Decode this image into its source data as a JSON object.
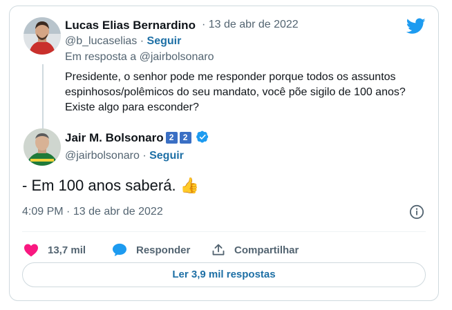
{
  "reply": {
    "author_name": "Lucas Elias Bernardino",
    "date": "13 de abr de 2022",
    "separator": "·",
    "handle": "@b_lucaselias",
    "follow_label": "Seguir",
    "in_reply_to_prefix": "Em resposta a",
    "in_reply_to_handle": "@jairbolsonaro",
    "text": "Presidente, o senhor pode me responder porque todos os assuntos espinhosos/polêmicos do seu mandato, você põe sigilo de 100 anos? Existe algo para esconder?"
  },
  "main": {
    "author_name": "Jair M. Bolsonaro",
    "badge_1": "2",
    "badge_2": "2",
    "handle": "@jairbolsonaro",
    "separator": "·",
    "follow_label": "Seguir",
    "text": "- Em 100 anos saberá.",
    "emoji": "👍",
    "time": "4:09 PM",
    "date": "13 de abr de 2022"
  },
  "actions": {
    "likes": "13,7 mil",
    "reply_label": "Responder",
    "share_label": "Compartilhar"
  },
  "read_replies_label": "Ler 3,9 mil respostas",
  "colors": {
    "accent": "#1d9bf0",
    "link": "#1d6fa5",
    "like": "#f91880",
    "muted": "#536471",
    "border": "#cfd9de"
  },
  "icons": [
    "twitter-bird-icon",
    "verified-badge-icon",
    "info-icon",
    "heart-icon",
    "reply-bubble-icon",
    "share-icon"
  ]
}
